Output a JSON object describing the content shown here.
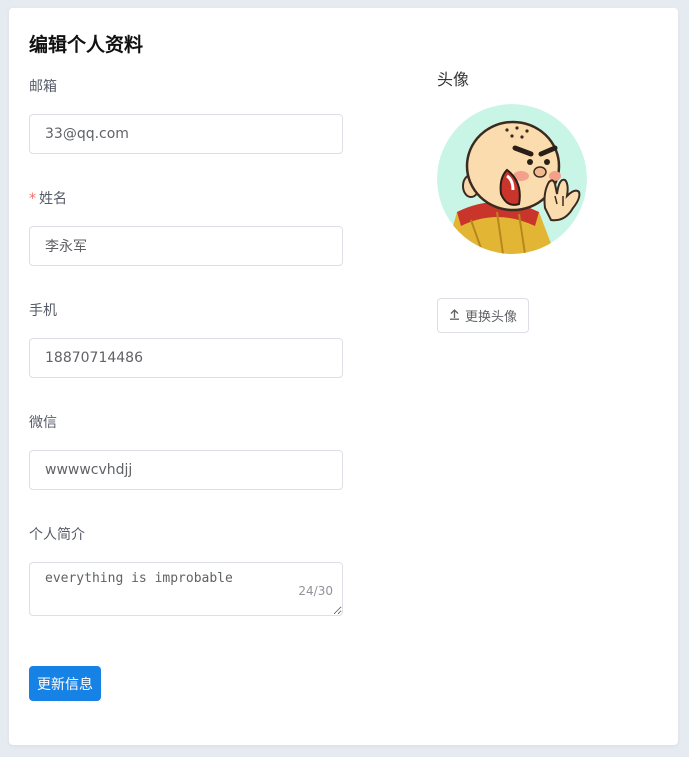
{
  "page": {
    "title": "编辑个人资料"
  },
  "form": {
    "email": {
      "label": "邮箱",
      "value": "33@qq.com"
    },
    "name": {
      "required_mark": "*",
      "label": "姓名",
      "value": "李永军"
    },
    "phone": {
      "label": "手机",
      "value": "18870714486"
    },
    "wechat": {
      "label": "微信",
      "value": "wwwwcvhdjj"
    },
    "bio": {
      "label": "个人简介",
      "value": "everything is improbable",
      "count": "24/30"
    },
    "submit_label": "更新信息"
  },
  "avatar": {
    "label": "头像",
    "upload_icon": "upload-icon",
    "change_label": "更换头像"
  },
  "colors": {
    "primary": "#1682e6",
    "required": "#f56c6c",
    "background": "#e6ebf1"
  }
}
